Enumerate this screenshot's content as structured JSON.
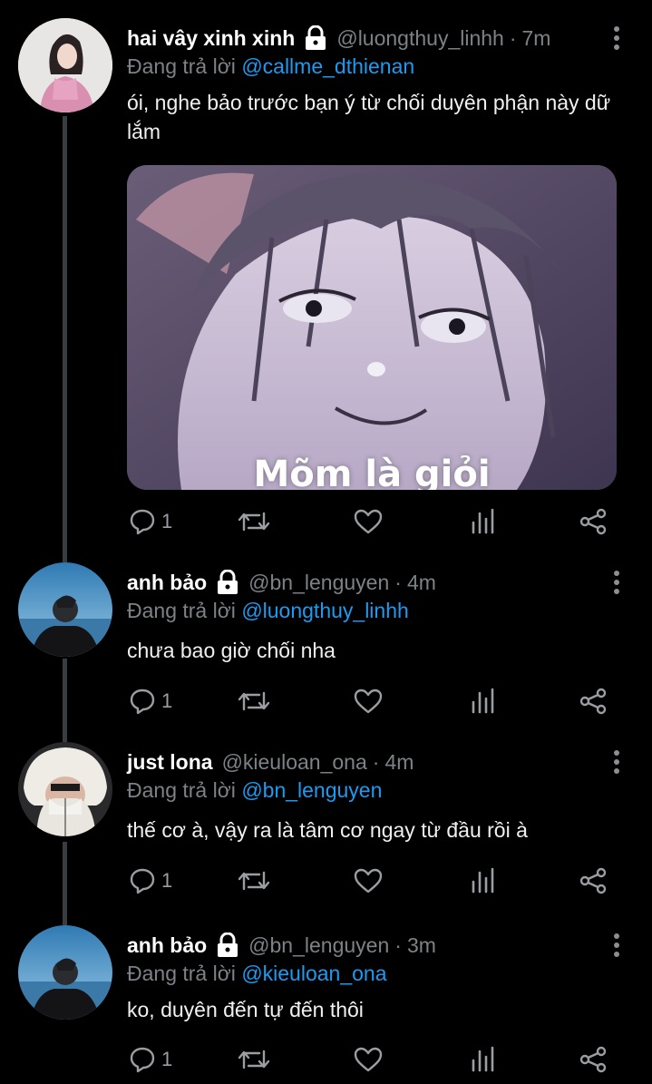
{
  "tweets": [
    {
      "name": "hai vây xinh xinh",
      "handle": "@luongthuy_linhh",
      "time": "7m",
      "reply_prefix": "Đang trả lời",
      "reply_to": "@callme_dthienan",
      "text": "ói, nghe bảo trước bạn ý từ chối duyên phận này dữ lắm",
      "media_caption": "Mõm là giỏi",
      "reply_count": "1"
    },
    {
      "name": "anh bảo",
      "handle": "@bn_lenguyen",
      "time": "4m",
      "reply_prefix": "Đang trả lời",
      "reply_to": "@luongthuy_linhh",
      "text": "chưa bao giờ chối nha",
      "reply_count": "1"
    },
    {
      "name": "just lona",
      "handle": "@kieuloan_ona",
      "time": "4m",
      "reply_prefix": "Đang trả lời",
      "reply_to": "@bn_lenguyen",
      "text": "thế cơ à, vậy ra là tâm cơ ngay từ đầu rồi à",
      "reply_count": "1"
    },
    {
      "name": "anh bảo",
      "handle": "@bn_lenguyen",
      "time": "3m",
      "reply_prefix": "Đang trả lời",
      "reply_to": "@kieuloan_ona",
      "text": "ko, duyên đến tự đến thôi",
      "reply_count": "1"
    }
  ],
  "separator": "·",
  "colors": {
    "background": "#000000",
    "link": "#1d9bf0",
    "muted": "#7d8287",
    "thread_line": "#3a3d40"
  },
  "icons": [
    "lock-icon",
    "more-icon",
    "reply-icon",
    "retweet-icon",
    "like-icon",
    "views-icon",
    "share-icon"
  ]
}
